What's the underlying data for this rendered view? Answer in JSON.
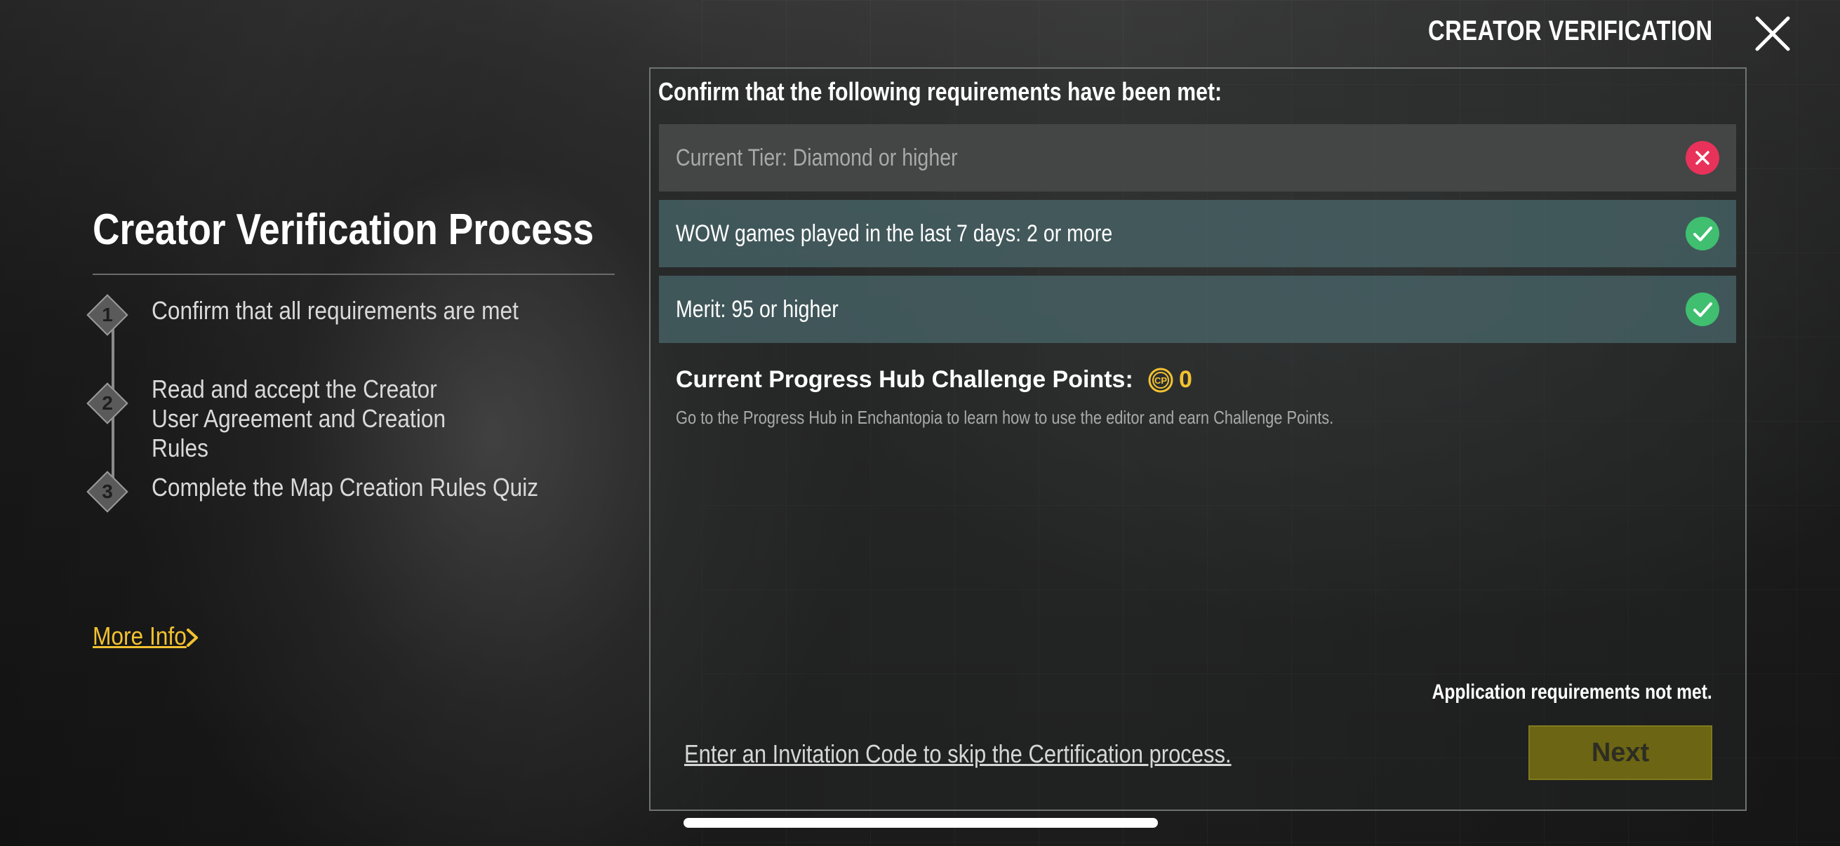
{
  "header": {
    "title": "CREATOR VERIFICATION",
    "close_icon": "close-icon"
  },
  "left": {
    "title": "Creator Verification Process",
    "steps": [
      {
        "number": "1",
        "text": "Confirm that all requirements are met"
      },
      {
        "number": "2",
        "text": "Read and accept the Creator User Agreement and Creation Rules"
      },
      {
        "number": "3",
        "text": "Complete the Map Creation Rules Quiz"
      }
    ],
    "more_info": "More Info"
  },
  "panel": {
    "heading": "Confirm that the following requirements have been met:",
    "requirements": [
      {
        "label": "Current Tier: Diamond or higher",
        "status": "not-met",
        "icon": "x-circle-icon"
      },
      {
        "label": "WOW games played in the last 7 days: 2 or more",
        "status": "met",
        "icon": "check-circle-icon"
      },
      {
        "label": "Merit: 95 or higher",
        "status": "met",
        "icon": "check-circle-icon"
      }
    ],
    "points_label": "Current Progress Hub Challenge Points:",
    "points_value": "0",
    "points_description": "Go to the Progress Hub in Enchantopia to learn how to use the editor and earn Challenge Points.",
    "status_message": "Application requirements not met.",
    "invitation_link": "Enter an Invitation Code to skip the Certification process.",
    "next_label": "Next"
  },
  "colors": {
    "accent_yellow": "#f2c230",
    "fail_red": "#e8325a",
    "pass_green": "#3fbf6f",
    "next_disabled": "#6c6513"
  }
}
